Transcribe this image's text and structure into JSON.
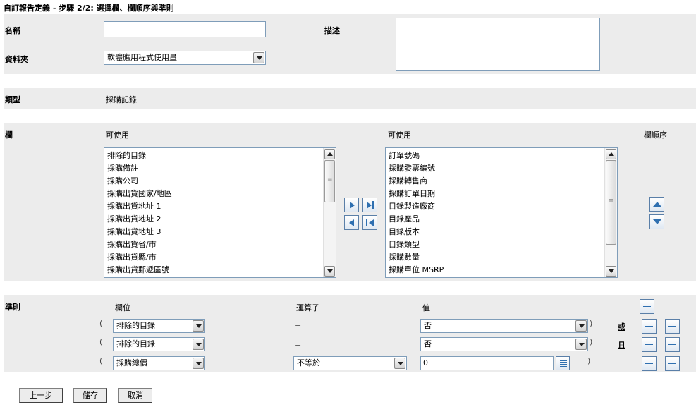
{
  "page_title": "自訂報告定義 - 步驟 2/2: 選擇欄、欄順序與準則",
  "form": {
    "name_label": "名稱",
    "name_value": "",
    "description_label": "描述",
    "description_value": "",
    "folder_label": "資料夾",
    "folder_value": "軟體應用程式使用量",
    "type_label": "類型",
    "type_value": "採購記錄"
  },
  "columns": {
    "label": "欄",
    "available_header": "可使用",
    "selected_header": "可使用",
    "order_header": "欄順序",
    "available_items": [
      "排除的目錄",
      "採購備註",
      "採購公司",
      "採購出貨國家/地區",
      "採購出貨地址 1",
      "採購出貨地址 2",
      "採購出貨地址 3",
      "採購出貨省/市",
      "採購出貨縣/市",
      "採購出貨郵遞區號"
    ],
    "selected_items": [
      "訂單號碼",
      "採購發票編號",
      "採購轉售商",
      "採購訂單日期",
      "目錄製造廠商",
      "目錄產品",
      "目錄版本",
      "目錄類型",
      "採購數量",
      "採購單位 MSRP"
    ]
  },
  "criteria": {
    "label": "準則",
    "field_header": "欄位",
    "operator_header": "運算子",
    "value_header": "值",
    "rows": [
      {
        "open_paren": "(",
        "field": "排除的目錄",
        "operator": "=",
        "value": "否",
        "close_paren": ")",
        "conjunction": "或"
      },
      {
        "open_paren": "(",
        "field": "排除的目錄",
        "operator": "=",
        "value": "否",
        "close_paren": ")",
        "conjunction": "且"
      },
      {
        "open_paren": "(",
        "field": "採購總價",
        "operator": "不等於",
        "value": "0",
        "close_paren": ")",
        "conjunction": ""
      }
    ]
  },
  "buttons": {
    "back": "上一步",
    "save": "儲存",
    "cancel": "取消"
  },
  "colors": {
    "band": "#ececec",
    "icon_blue": "#2e6fb0",
    "border": "#7f9db9"
  }
}
